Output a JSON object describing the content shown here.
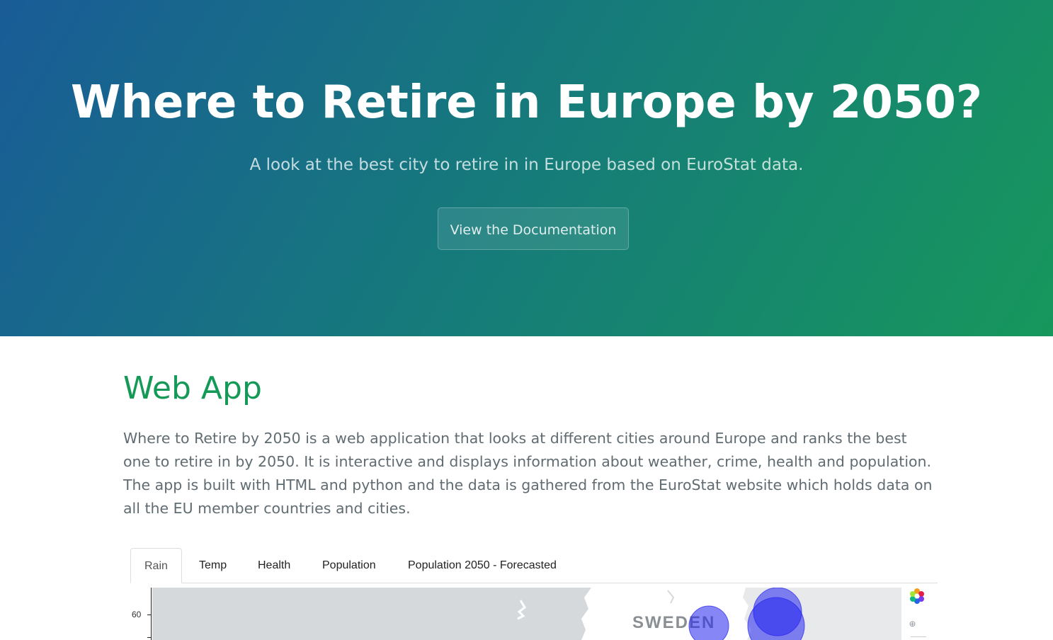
{
  "hero": {
    "title": "Where to Retire in Europe by 2050?",
    "tagline": "A look at the best city to retire in in Europe based on EuroStat data.",
    "button_label": "View the Documentation"
  },
  "section": {
    "heading": "Web App",
    "body": "Where to Retire by 2050 is a web application that looks at different cities around Europe and ranks the best one to retire in by 2050. It is interactive and displays information about weather, crime, health and population. The app is built with HTML and python and the data is gathered from the EuroStat website which holds data on all the EU member countries and cities."
  },
  "tabs": [
    {
      "label": "Rain",
      "active": true
    },
    {
      "label": "Temp",
      "active": false
    },
    {
      "label": "Health",
      "active": false
    },
    {
      "label": "Population",
      "active": false
    },
    {
      "label": "Population 2050 - Forecasted",
      "active": false
    }
  ],
  "plot": {
    "y_tick_label": "60",
    "map_label": "SWEDEN",
    "colors": {
      "land": "#ffffff",
      "sea": "#d6d9dc",
      "bubble": "#2222ee"
    }
  }
}
